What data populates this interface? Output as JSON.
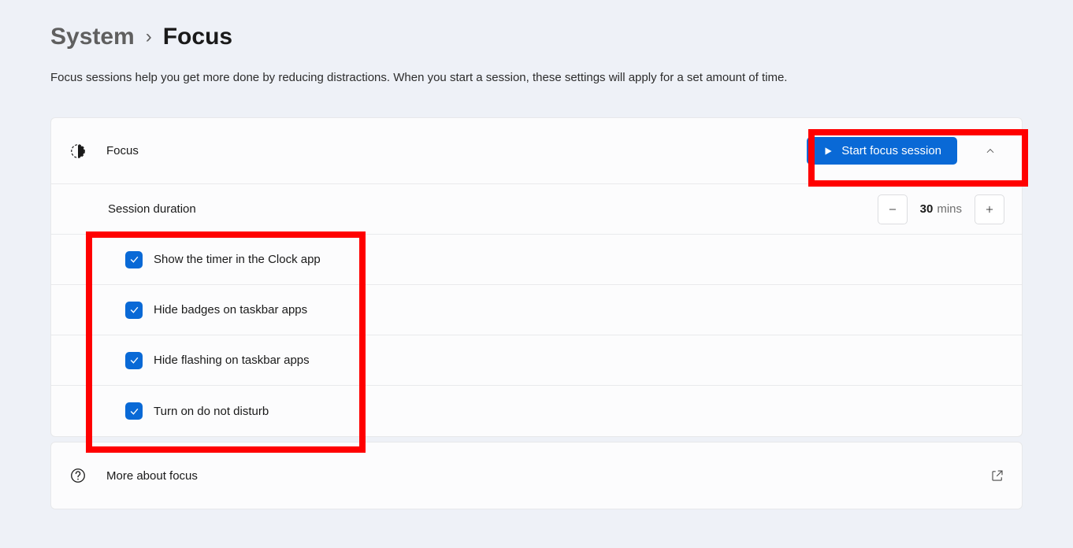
{
  "breadcrumb": {
    "parent": "System",
    "separator": "›",
    "current": "Focus"
  },
  "description": "Focus sessions help you get more done by reducing distractions. When you start a session, these settings will apply for a set amount of time.",
  "focus": {
    "label": "Focus",
    "start_button": "Start focus session",
    "session_duration_label": "Session duration",
    "duration_value": "30",
    "duration_unit": "mins",
    "options": [
      {
        "label": "Show the timer in the Clock app",
        "checked": true
      },
      {
        "label": "Hide badges on taskbar apps",
        "checked": true
      },
      {
        "label": "Hide flashing on taskbar apps",
        "checked": true
      },
      {
        "label": "Turn on do not disturb",
        "checked": true
      }
    ]
  },
  "more_about": {
    "label": "More about focus"
  }
}
